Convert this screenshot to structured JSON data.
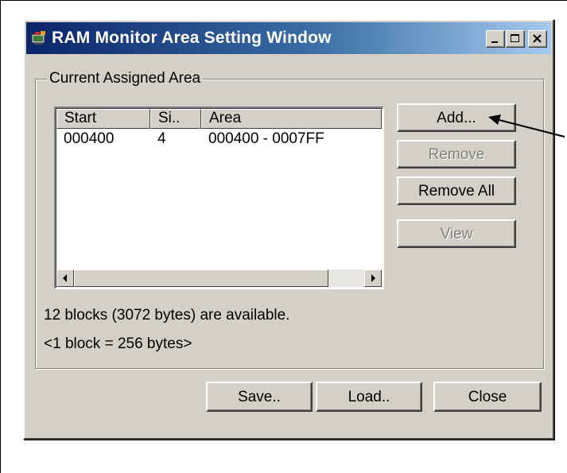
{
  "window": {
    "title": "RAM Monitor Area Setting Window",
    "controls": {
      "minimize_icon": "minimize-icon",
      "maximize_icon": "maximize-icon",
      "close_icon": "close-icon"
    }
  },
  "group": {
    "label": "Current Assigned Area"
  },
  "table": {
    "columns": [
      "Start",
      "Si..",
      "Area"
    ],
    "rows": [
      {
        "start": "000400",
        "size": "4",
        "area": "000400 - 0007FF"
      }
    ]
  },
  "side_buttons": {
    "add": "Add...",
    "remove": "Remove",
    "remove_all": "Remove All",
    "view": "View"
  },
  "info": {
    "available": "12 blocks (3072 bytes) are available.",
    "block_size": "<1 block = 256 bytes>"
  },
  "bottom_buttons": {
    "save": "Save..",
    "load": "Load..",
    "close": "Close"
  },
  "colors": {
    "face": "#d4d0c8",
    "titlebar_start": "#0a246a",
    "titlebar_end": "#a6caf0",
    "disabled_text": "#808080"
  }
}
